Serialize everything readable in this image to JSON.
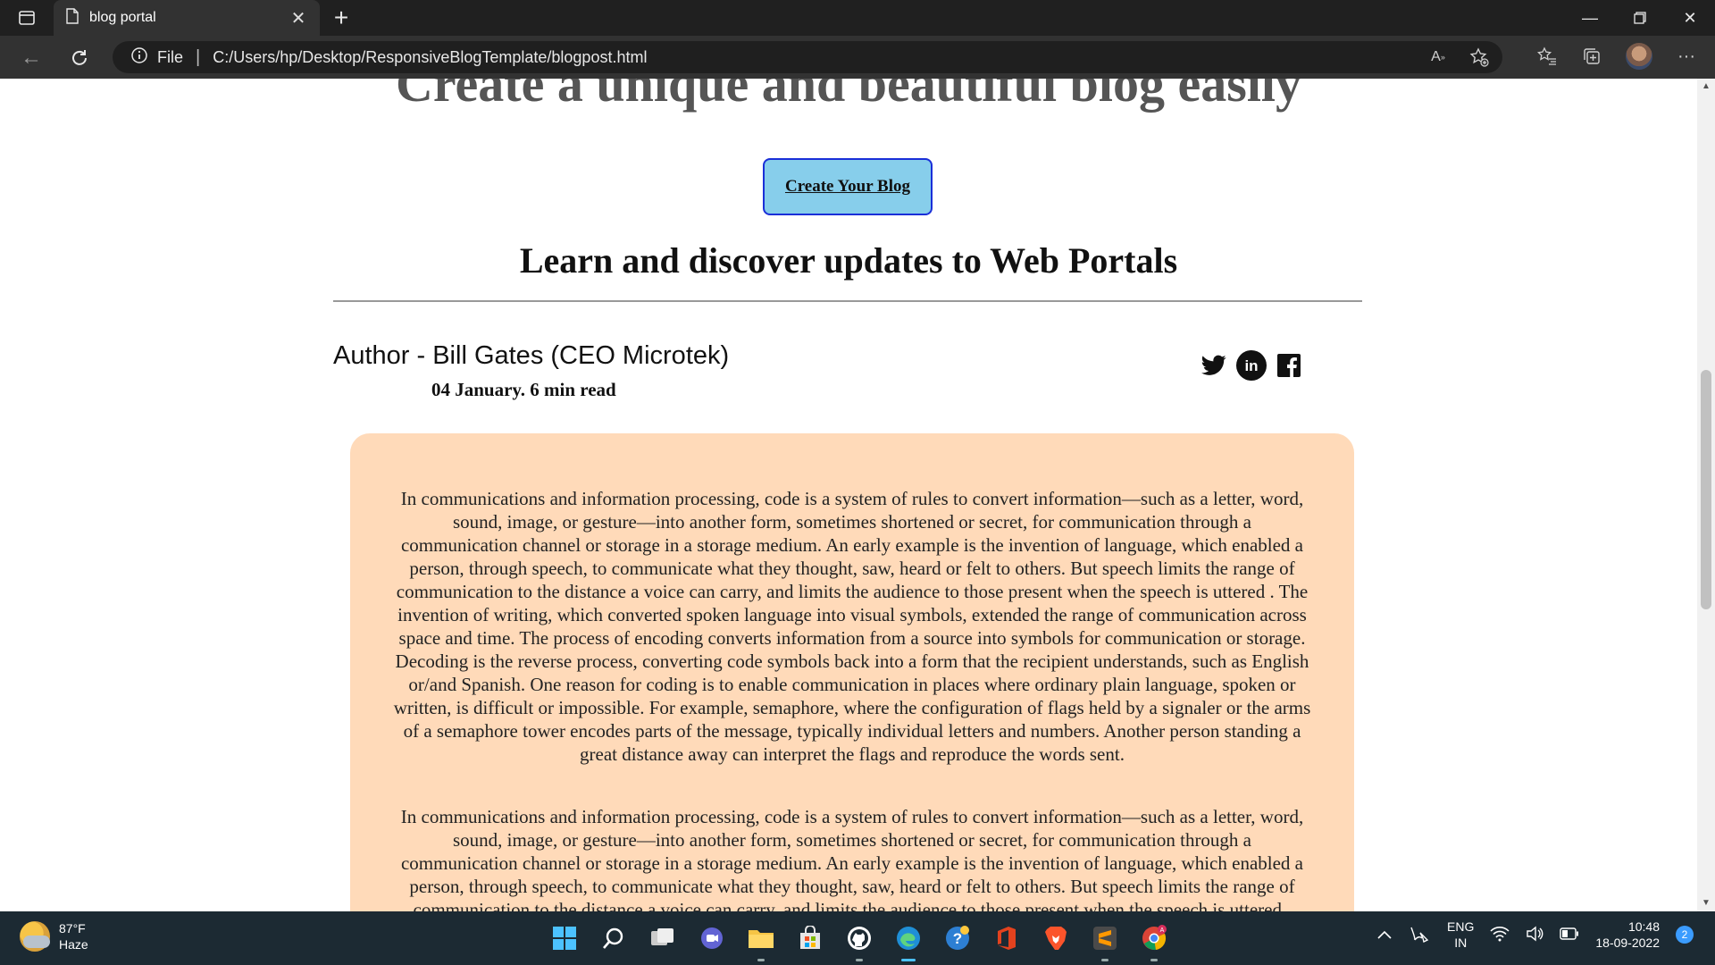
{
  "browser": {
    "tab_title": "blog portal",
    "address_prefix": "File",
    "url": "C:/Users/hp/Desktop/ResponsiveBlogTemplate/blogpost.html"
  },
  "page": {
    "hero_title": "Create a unique and beautiful blog easily",
    "cta_label": "Create Your Blog",
    "section_heading": "Learn and discover updates to Web Portals",
    "author": "Author - Bill Gates (CEO Microtek)",
    "meta": "04 January. 6 min read",
    "paragraphs": [
      "In communications and information processing, code is a system of rules to convert information—such as a letter, word, sound, image, or gesture—into another form, sometimes shortened or secret, for communication through a communication channel or storage in a storage medium. An early example is the invention of language, which enabled a person, through speech, to communicate what they thought, saw, heard or felt to others. But speech limits the range of communication to the distance a voice can carry, and limits the audience to those present when the speech is uttered . The invention of writing, which converted spoken language into visual symbols, extended the range of communication across space and time. The process of encoding converts information from a source into symbols for communication or storage. Decoding is the reverse process, converting code symbols back into a form that the recipient understands, such as English or/and Spanish. One reason for coding is to enable communication in places where ordinary plain language, spoken or written, is difficult or impossible. For example, semaphore, where the configuration of flags held by a signaler or the arms of a semaphore tower encodes parts of the message, typically individual letters and numbers. Another person standing a great distance away can interpret the flags and reproduce the words sent.",
      "In communications and information processing, code is a system of rules to convert information—such as a letter, word, sound, image, or gesture—into another form, sometimes shortened or secret, for communication through a communication channel or storage in a storage medium. An early example is the invention of language, which enabled a person, through speech, to communicate what they thought, saw, heard or felt to others. But speech limits the range of communication to the distance a voice can carry, and limits the audience to those present when the speech is uttered ."
    ]
  },
  "taskbar": {
    "temperature": "87°F",
    "weather": "Haze",
    "lang_line1": "ENG",
    "lang_line2": "IN",
    "time": "10:48",
    "date": "18-09-2022",
    "notifications": "2"
  },
  "icons": [
    "tab-actions-icon",
    "page-icon",
    "close-icon",
    "plus-icon",
    "minimize-icon",
    "restore-icon",
    "back-icon",
    "refresh-icon",
    "info-icon",
    "read-aloud-icon",
    "add-favorite-icon",
    "favorites-icon",
    "collections-icon",
    "more-icon",
    "twitter-icon",
    "linkedin-icon",
    "facebook-icon"
  ]
}
